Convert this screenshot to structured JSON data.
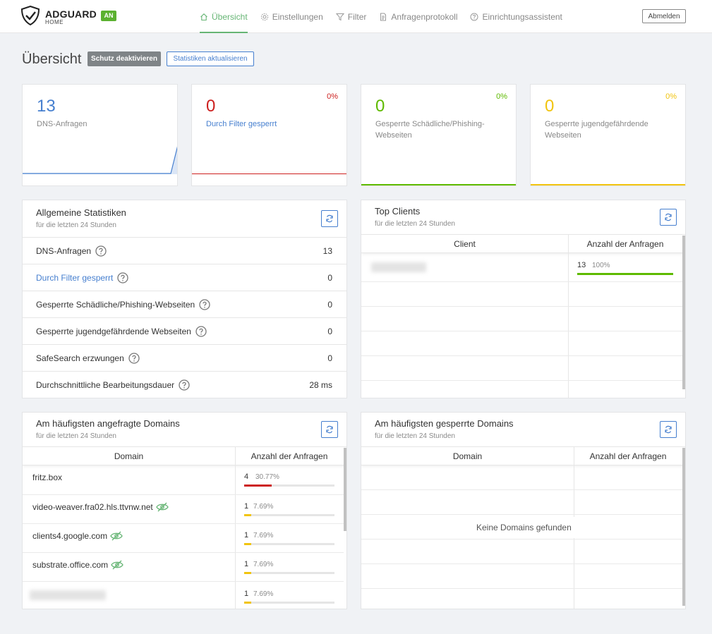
{
  "header": {
    "brand": "ADGUARD",
    "brand_sub": "HOME",
    "status_badge": "AN",
    "nav": [
      {
        "label": "Übersicht",
        "icon": "home-icon"
      },
      {
        "label": "Einstellungen",
        "icon": "gear-icon"
      },
      {
        "label": "Filter",
        "icon": "filter-icon"
      },
      {
        "label": "Anfragenprotokoll",
        "icon": "document-icon"
      },
      {
        "label": "Einrichtungsassistent",
        "icon": "help-circle-icon"
      }
    ],
    "logout_label": "Abmelden"
  },
  "page": {
    "title": "Übersicht",
    "disable_protection_label": "Schutz deaktivieren",
    "refresh_stats_label": "Statistiken aktualisieren"
  },
  "colors": {
    "blue": "#467fcf",
    "red": "#cd201f",
    "green": "#5eba00",
    "yellow": "#f1c40f",
    "brand_green": "#66b574"
  },
  "stat_cards": [
    {
      "value": "13",
      "label": "DNS-Anfragen",
      "percent": ""
    },
    {
      "value": "0",
      "label": "Durch Filter gesperrt",
      "percent": "0%"
    },
    {
      "value": "0",
      "label": "Gesperrte Schädliche/Phishing-Webseiten",
      "percent": "0%"
    },
    {
      "value": "0",
      "label": "Gesperrte jugendgefährdende Webseiten",
      "percent": "0%"
    }
  ],
  "general_stats": {
    "title": "Allgemeine Statistiken",
    "subtitle": "für die letzten 24 Stunden",
    "rows": [
      {
        "label": "DNS-Anfragen",
        "value": "13"
      },
      {
        "label": "Durch Filter gesperrt",
        "value": "0"
      },
      {
        "label": "Gesperrte Schädliche/Phishing-Webseiten",
        "value": "0"
      },
      {
        "label": "Gesperrte jugendgefährdende Webseiten",
        "value": "0"
      },
      {
        "label": "SafeSearch erzwungen",
        "value": "0"
      },
      {
        "label": "Durchschnittliche Bearbeitungsdauer",
        "value": "28 ms"
      }
    ]
  },
  "top_clients": {
    "title": "Top Clients",
    "subtitle": "für die letzten 24 Stunden",
    "col_client": "Client",
    "col_count": "Anzahl der Anfragen",
    "rows": [
      {
        "count": "13",
        "percent": "100%",
        "fraction": 1.0
      }
    ]
  },
  "top_domains": {
    "title": "Am häufigsten angefragte Domains",
    "subtitle": "für die letzten 24 Stunden",
    "col_domain": "Domain",
    "col_count": "Anzahl der Anfragen",
    "rows": [
      {
        "domain": "fritz.box",
        "count": "4",
        "percent": "30.77%",
        "fraction": 0.3077,
        "tracker": false
      },
      {
        "domain": "video-weaver.fra02.hls.ttvnw.net",
        "count": "1",
        "percent": "7.69%",
        "fraction": 0.0769,
        "tracker": true
      },
      {
        "domain": "clients4.google.com",
        "count": "1",
        "percent": "7.69%",
        "fraction": 0.0769,
        "tracker": true
      },
      {
        "domain": "substrate.office.com",
        "count": "1",
        "percent": "7.69%",
        "fraction": 0.0769,
        "tracker": true
      },
      {
        "domain": "",
        "count": "1",
        "percent": "7.69%",
        "fraction": 0.0769,
        "tracker": false
      }
    ]
  },
  "blocked_domains": {
    "title": "Am häufigsten gesperrte Domains",
    "subtitle": "für die letzten 24 Stunden",
    "col_domain": "Domain",
    "col_count": "Anzahl der Anfragen",
    "empty_text": "Keine Domains gefunden"
  }
}
